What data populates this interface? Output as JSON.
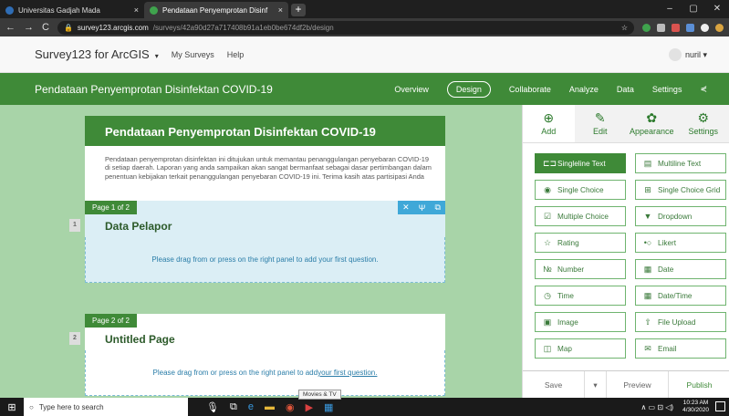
{
  "browser": {
    "tabs": [
      {
        "title": "Universitas Gadjah Mada",
        "close": "×",
        "color": "#2f6db5"
      },
      {
        "title": "Pendataan Penyemprotan Disinf",
        "close": "×",
        "color": "#3fa34d"
      }
    ],
    "new_tab": "+",
    "window_controls": [
      "–",
      "▢",
      "✕"
    ],
    "nav": [
      "←",
      "→",
      "C"
    ],
    "url_host": "survey123.arcgis.com",
    "url_path": "/surveys/42a90d27a717408b91a1eb0be674df2b/design",
    "star": "☆"
  },
  "app": {
    "brand": "Survey123 for ArcGIS",
    "brand_caret": "▾",
    "links": [
      "My Surveys",
      "Help"
    ],
    "user": "nuril ▾"
  },
  "survey_bar": {
    "title": "Pendataan Penyemprotan Disinfektan COVID-19",
    "nav": [
      "Overview",
      "Design",
      "Collaborate",
      "Analyze",
      "Data",
      "Settings"
    ],
    "active": "Design",
    "share_icon": "⋞"
  },
  "form": {
    "title": "Pendataan Penyemprotan Disinfektan COVID-19",
    "description": "Pendataan penyemprotan disinfektan ini ditujukan untuk memantau penanggulangan penyebaran COVID-19 di setiap daerah. Laporan yang anda sampaikan akan sangat bermanfaat sebagai dasar pertimbangan dalam penentuan kebijakan terkait penanggulangan penyebaran COVID-19 ini. Terima kasih atas partisipasi Anda",
    "pages": [
      {
        "tag": "Page 1 of 2",
        "num": "1",
        "title": "Data Pelapor",
        "drop_pre": "Please drag from or press on the right panel to add your first question.",
        "drop_link": ""
      },
      {
        "tag": "Page 2 of 2",
        "num": "2",
        "title": "Untitled Page",
        "drop_pre": "Please drag from or press on the right panel to add ",
        "drop_link": "your first question."
      }
    ],
    "page_tools": [
      "✕",
      "Ψ",
      "⧉"
    ]
  },
  "panel": {
    "tabs": [
      {
        "label": "Add",
        "icon": "⊕"
      },
      {
        "label": "Edit",
        "icon": "✎"
      },
      {
        "label": "Appearance",
        "icon": "✿"
      },
      {
        "label": "Settings",
        "icon": "⚙"
      }
    ],
    "questions": [
      {
        "label": "Singleline Text",
        "icon": "⊏⊐"
      },
      {
        "label": "Multiline Text",
        "icon": "▤"
      },
      {
        "label": "Single Choice",
        "icon": "◉"
      },
      {
        "label": "Single Choice Grid",
        "icon": "⊞"
      },
      {
        "label": "Multiple Choice",
        "icon": "☑"
      },
      {
        "label": "Dropdown",
        "icon": "▼"
      },
      {
        "label": "Rating",
        "icon": "☆"
      },
      {
        "label": "Likert",
        "icon": "•○"
      },
      {
        "label": "Number",
        "icon": "№"
      },
      {
        "label": "Date",
        "icon": "▦"
      },
      {
        "label": "Time",
        "icon": "◷"
      },
      {
        "label": "Date/Time",
        "icon": "▦"
      },
      {
        "label": "Image",
        "icon": "▣"
      },
      {
        "label": "File Upload",
        "icon": "⇧"
      },
      {
        "label": "Map",
        "icon": "◫"
      },
      {
        "label": "Email",
        "icon": "✉"
      }
    ],
    "footer": [
      "Save",
      "▾",
      "Preview",
      "Publish"
    ]
  },
  "taskbar": {
    "start": "⊞",
    "search_placeholder": "Type here to search",
    "search_icon": "○",
    "apps": [
      "🎙",
      "⧉",
      "e",
      "▬",
      "◉",
      "▶",
      "▦"
    ],
    "tooltip": "Movies & TV",
    "tray": "∧  ▭  ⊡  ◁)",
    "time": "10:23 AM",
    "date": "4/30/2020"
  }
}
